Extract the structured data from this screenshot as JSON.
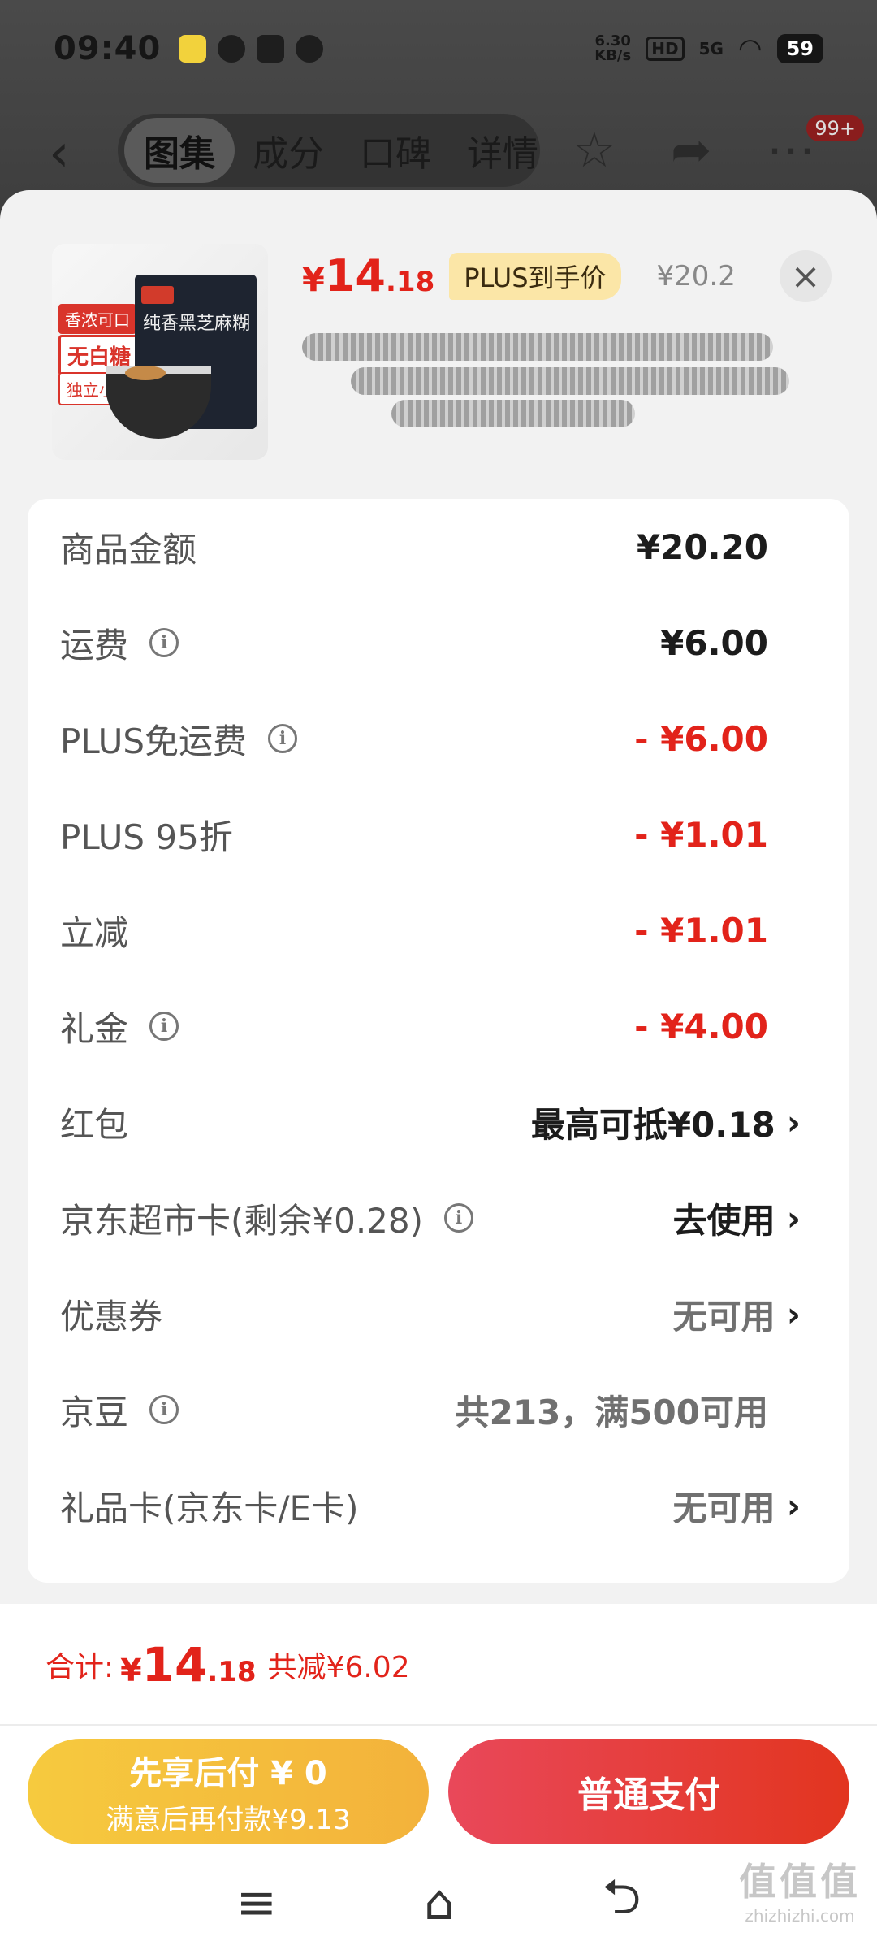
{
  "status_bar": {
    "time": "09:40",
    "net_speed_value": "6.30",
    "net_speed_unit": "KB/s",
    "hd_label": "HD",
    "signal_label": "5G",
    "battery": "59"
  },
  "nav": {
    "tabs": [
      {
        "label": "图集",
        "active": true
      },
      {
        "label": "成分"
      },
      {
        "label": "口碑"
      },
      {
        "label": "详情"
      }
    ],
    "badge_count": "99+"
  },
  "product": {
    "image_labels": [
      "香浓可口",
      "无白糖",
      "独立小包"
    ],
    "package_text": "纯香黑芝麻糊",
    "price_currency": "¥",
    "price_int": "14",
    "price_dec": ".18",
    "plus_badge": "PLUS到手价",
    "original_price": "¥20.2"
  },
  "details": {
    "rows": [
      {
        "label": "商品金额",
        "value": "¥20.20",
        "style": "normal",
        "info": false,
        "chevron": false
      },
      {
        "label": "运费",
        "value": "¥6.00",
        "style": "normal",
        "info": true,
        "chevron": false
      },
      {
        "label": "PLUS免运费",
        "value": "- ¥6.00",
        "style": "red",
        "info": true,
        "chevron": false
      },
      {
        "label": "PLUS 95折",
        "value": "- ¥1.01",
        "style": "red",
        "info": false,
        "chevron": false
      },
      {
        "label": "立减",
        "value": "- ¥1.01",
        "style": "red",
        "info": false,
        "chevron": false
      },
      {
        "label": "礼金",
        "value": "- ¥4.00",
        "style": "red",
        "info": true,
        "chevron": false
      },
      {
        "label": "红包",
        "value": "最高可抵¥0.18",
        "style": "normal",
        "info": false,
        "chevron": true
      },
      {
        "label": "京东超市卡(剩余¥0.28)",
        "value": "去使用",
        "style": "normal",
        "info": true,
        "chevron": true
      },
      {
        "label": "优惠券",
        "value": "无可用",
        "style": "gray",
        "info": false,
        "chevron": true
      },
      {
        "label": "京豆",
        "value": "共213，满500可用",
        "style": "gray",
        "info": true,
        "chevron": false
      },
      {
        "label": "礼品卡(京东卡/E卡)",
        "value": "无可用",
        "style": "gray",
        "info": false,
        "chevron": true
      }
    ]
  },
  "total": {
    "label": "合计:",
    "currency": "¥",
    "int": "14",
    "dec": ".18",
    "savings": "共减¥6.02"
  },
  "buttons": {
    "pay_later_title": "先享后付 ¥ 0",
    "pay_later_sub": "满意后再付款¥9.13",
    "pay_normal": "普通支付"
  },
  "watermark": {
    "logo": "值值值",
    "url": "zhizhizhi.com"
  },
  "colors": {
    "accent_red": "#e2231a",
    "plus_gold": "#fbe6a7",
    "pay_later_yellow": "#f3b23b"
  }
}
